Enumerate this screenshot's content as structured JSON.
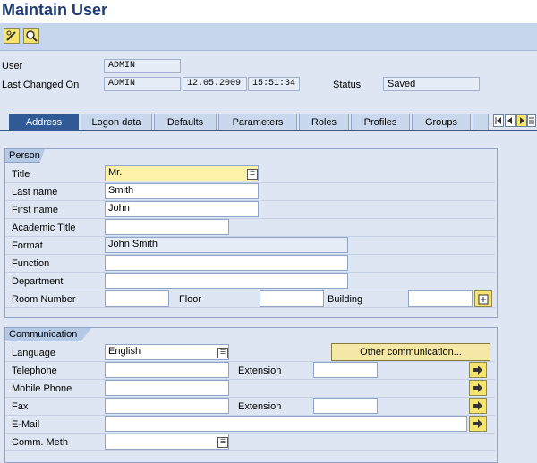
{
  "app": {
    "title": "Maintain User"
  },
  "header": {
    "user_label": "User",
    "user_value": "ADMIN",
    "changed_label": "Last Changed On",
    "changed_by": "ADMIN",
    "changed_date": "12.05.2009",
    "changed_time": "15:51:34",
    "status_label": "Status",
    "status_value": "Saved"
  },
  "tabs": [
    {
      "label": "Address",
      "active": true
    },
    {
      "label": "Logon data"
    },
    {
      "label": "Defaults"
    },
    {
      "label": "Parameters"
    },
    {
      "label": "Roles"
    },
    {
      "label": "Profiles"
    },
    {
      "label": "Groups"
    }
  ],
  "person": {
    "group_title": "Person",
    "title_label": "Title",
    "title_value": "Mr.",
    "last_name_label": "Last name",
    "last_name_value": "Smith",
    "first_name_label": "First name",
    "first_name_value": "John",
    "academic_title_label": "Academic Title",
    "academic_title_value": "",
    "format_label": "Format",
    "format_value": "John Smith",
    "function_label": "Function",
    "function_value": "",
    "department_label": "Department",
    "department_value": "",
    "room_label": "Room Number",
    "room_value": "",
    "floor_label": "Floor",
    "floor_value": "",
    "building_label": "Building",
    "building_value": ""
  },
  "communication": {
    "group_title": "Communication",
    "language_label": "Language",
    "language_value": "English",
    "other_comm_button": "Other communication...",
    "telephone_label": "Telephone",
    "telephone_value": "",
    "extension_label": "Extension",
    "telephone_ext_value": "",
    "mobile_label": "Mobile Phone",
    "mobile_value": "",
    "fax_label": "Fax",
    "fax_value": "",
    "fax_ext_value": "",
    "email_label": "E-Mail",
    "email_value": "",
    "comm_meth_label": "Comm. Meth",
    "comm_meth_value": ""
  },
  "colors": {
    "title": "#1f3c73",
    "active_tab": "#2f5a96",
    "required_field": "#fdf2a8",
    "button": "#f5e8a6",
    "background": "#dde6f2"
  }
}
